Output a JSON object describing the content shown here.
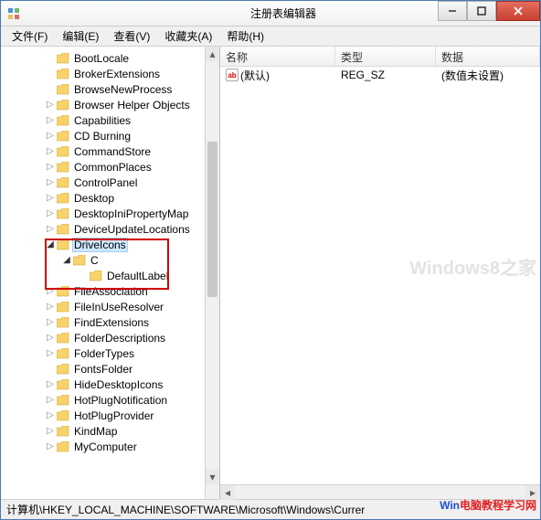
{
  "window": {
    "title": "注册表编辑器"
  },
  "menu": {
    "file": "文件(F)",
    "edit": "编辑(E)",
    "view": "查看(V)",
    "favorites": "收藏夹(A)",
    "help": "帮助(H)"
  },
  "tree": {
    "items": [
      {
        "label": "BootLocale",
        "indent": 60
      },
      {
        "label": "BrokerExtensions",
        "indent": 60
      },
      {
        "label": "BrowseNewProcess",
        "indent": 60
      },
      {
        "label": "Browser Helper Objects",
        "indent": 60,
        "exp": "▷"
      },
      {
        "label": "Capabilities",
        "indent": 60,
        "exp": "▷"
      },
      {
        "label": "CD Burning",
        "indent": 60,
        "exp": "▷"
      },
      {
        "label": "CommandStore",
        "indent": 60,
        "exp": "▷"
      },
      {
        "label": "CommonPlaces",
        "indent": 60,
        "exp": "▷"
      },
      {
        "label": "ControlPanel",
        "indent": 60,
        "exp": "▷"
      },
      {
        "label": "Desktop",
        "indent": 60,
        "exp": "▷"
      },
      {
        "label": "DesktopIniPropertyMap",
        "indent": 60,
        "exp": "▷"
      },
      {
        "label": "DeviceUpdateLocations",
        "indent": 60,
        "exp": "▷"
      },
      {
        "label": "DriveIcons",
        "indent": 60,
        "exp": "◢",
        "selected": true
      },
      {
        "label": "C",
        "indent": 78,
        "exp": "◢"
      },
      {
        "label": "DefaultLabel",
        "indent": 96
      },
      {
        "label": "FileAssociation",
        "indent": 60,
        "exp": "▷"
      },
      {
        "label": "FileInUseResolver",
        "indent": 60,
        "exp": "▷"
      },
      {
        "label": "FindExtensions",
        "indent": 60,
        "exp": "▷"
      },
      {
        "label": "FolderDescriptions",
        "indent": 60,
        "exp": "▷"
      },
      {
        "label": "FolderTypes",
        "indent": 60,
        "exp": "▷"
      },
      {
        "label": "FontsFolder",
        "indent": 60
      },
      {
        "label": "HideDesktopIcons",
        "indent": 60,
        "exp": "▷"
      },
      {
        "label": "HotPlugNotification",
        "indent": 60,
        "exp": "▷"
      },
      {
        "label": "HotPlugProvider",
        "indent": 60,
        "exp": "▷"
      },
      {
        "label": "KindMap",
        "indent": 60,
        "exp": "▷"
      },
      {
        "label": "MyComputer",
        "indent": 60,
        "exp": "▷"
      }
    ]
  },
  "list": {
    "headers": {
      "name": "名称",
      "type": "类型",
      "data": "数据"
    },
    "rows": [
      {
        "name": "(默认)",
        "type": "REG_SZ",
        "data": "(数值未设置)"
      }
    ]
  },
  "statusbar": {
    "path": "计算机\\HKEY_LOCAL_MACHINE\\SOFTWARE\\Microsoft\\Windows\\Currer"
  },
  "watermark": {
    "line1": "Windows8之家",
    "line2a": "Win",
    "line2b": "电脑教程学习网"
  }
}
